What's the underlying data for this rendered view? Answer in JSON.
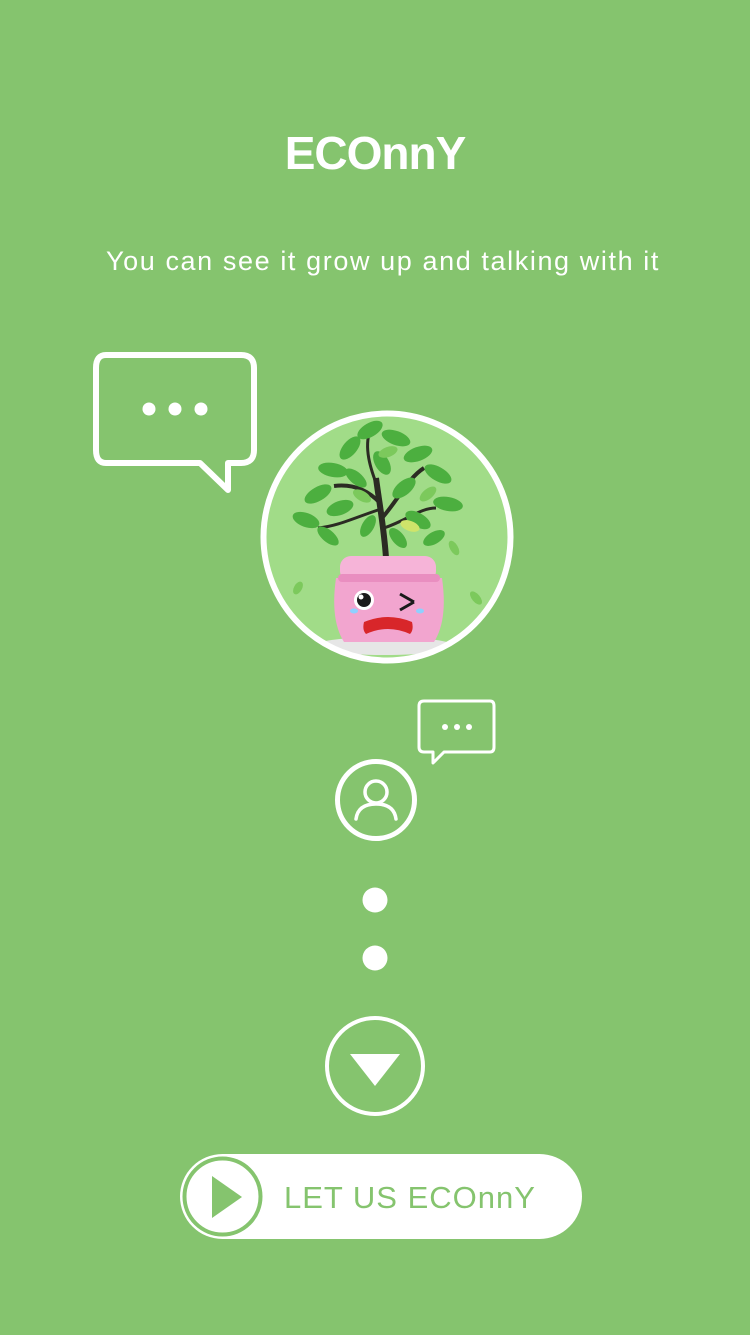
{
  "header": {
    "title": "ECOnnY",
    "subtitle": "You can see it grow up and talking with it"
  },
  "illustration": {
    "large_bubble_icon": "speech-bubble-dots-icon",
    "plant_avatar": "potted-plant-crying-face",
    "small_bubble_icon": "speech-bubble-dots-icon",
    "user_icon": "user-profile-icon",
    "progress_dots": 2,
    "next_icon": "down-triangle-circle-icon"
  },
  "cta": {
    "label": "LET US ECOnnY",
    "icon": "play-icon"
  },
  "colors": {
    "background": "#85c46e",
    "foreground": "#ffffff",
    "pot_pink": "#f2a5cf",
    "leaf_green": "#4caf3f"
  }
}
